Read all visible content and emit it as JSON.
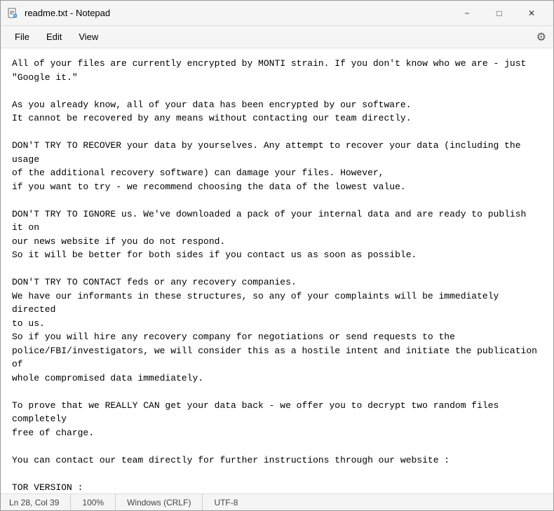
{
  "window": {
    "title": "readme.txt - Notepad",
    "icon": "notepad"
  },
  "titlebar": {
    "minimize_label": "−",
    "maximize_label": "□",
    "close_label": "✕"
  },
  "menubar": {
    "items": [
      "File",
      "Edit",
      "View"
    ],
    "settings_icon": "⚙"
  },
  "content": {
    "text": "All of your files are currently encrypted by MONTI strain. If you don't know who we are - just\n\"Google it.\"\n\nAs you already know, all of your data has been encrypted by our software.\nIt cannot be recovered by any means without contacting our team directly.\n\nDON'T TRY TO RECOVER your data by yourselves. Any attempt to recover your data (including the usage\nof the additional recovery software) can damage your files. However,\nif you want to try - we recommend choosing the data of the lowest value.\n\nDON'T TRY TO IGNORE us. We've downloaded a pack of your internal data and are ready to publish it on\nour news website if you do not respond.\nSo it will be better for both sides if you contact us as soon as possible.\n\nDON'T TRY TO CONTACT feds or any recovery companies.\nWe have our informants in these structures, so any of your complaints will be immediately directed\nto us.\nSo if you will hire any recovery company for negotiations or send requests to the\npolice/FBI/investigators, we will consider this as a hostile intent and initiate the publication of\nwhole compromised data immediately.\n\nTo prove that we REALLY CAN get your data back - we offer you to decrypt two random files completely\nfree of charge.\n\nYou can contact our team directly for further instructions through our website :\n\nTOR VERSION :\n(you should download and install TOR browser first https://torproject.org)\n\nhttp://4s4lnfeujzo67fy2jebz2dxskez2gsqj2jeb35m75ktufxensdicqxad.onion/chat/3194223a728c446ebfb50c494\nadb674da4d8c5622e124bcca9943f2b9a3f35f7/\n\nYOU SHOULD BE AWARE!\nWe will speak only with an authorized person. It can be the CEO, top management, etc.\nIn case you are not such a person - DON'T CONTACT US! Your decisions and action can result in\nserious harm to your company!\nInform your supervisors and stay calm!"
  },
  "statusbar": {
    "position": "Ln 28, Col 39",
    "zoom": "100%",
    "line_ending": "Windows (CRLF)",
    "encoding": "UTF-8"
  }
}
